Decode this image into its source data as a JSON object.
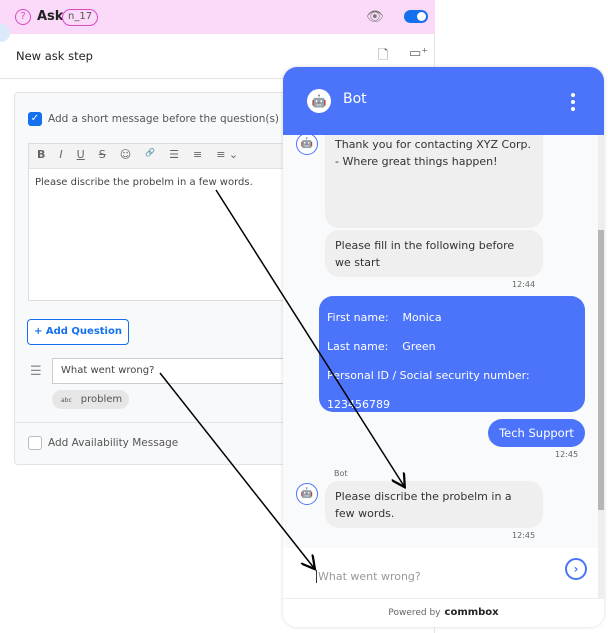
{
  "step": {
    "type": "Ask",
    "id": "n_17",
    "name": "New ask step"
  },
  "form": {
    "short_message_label": "Add a short message before the question(s)",
    "short_message_checked": true,
    "toolbar": [
      "B",
      "I",
      "U",
      "S",
      "☺",
      "🔗",
      "☰",
      "≡",
      "≡ ⌄"
    ],
    "message_text": "Please discribe the probelm in a few words.",
    "add_question_label": "+ Add Question",
    "question_value": "What went wrong?",
    "variable_chip_type": "abc",
    "variable_chip": "problem",
    "availability_label": "Add Availability Message",
    "availability_checked": false
  },
  "chat": {
    "title": "Bot",
    "messages": [
      {
        "from": "bot",
        "text": "Thank you for contacting XYZ Corp. - Where great things happen!"
      },
      {
        "from": "bot",
        "text": "Please fill in the following before we start",
        "time": "12:44"
      },
      {
        "from": "user",
        "lines": [
          "First name:    Monica",
          "Last name:    Green",
          "Personal ID / Social security number:",
          "123456789"
        ]
      },
      {
        "from": "user",
        "text": "Tech Support",
        "time": "12:45"
      },
      {
        "from": "bot",
        "sender": "Bot",
        "text": "Please discribe the probelm in a few words.",
        "time": "12:45"
      }
    ],
    "input_placeholder": "What went wrong?",
    "powered_by": "Powered by",
    "brand": "commbox"
  },
  "colors": {
    "accent": "#1570ef",
    "chat_blue": "#4c74fb",
    "header_pink": "#fbd9f8"
  }
}
